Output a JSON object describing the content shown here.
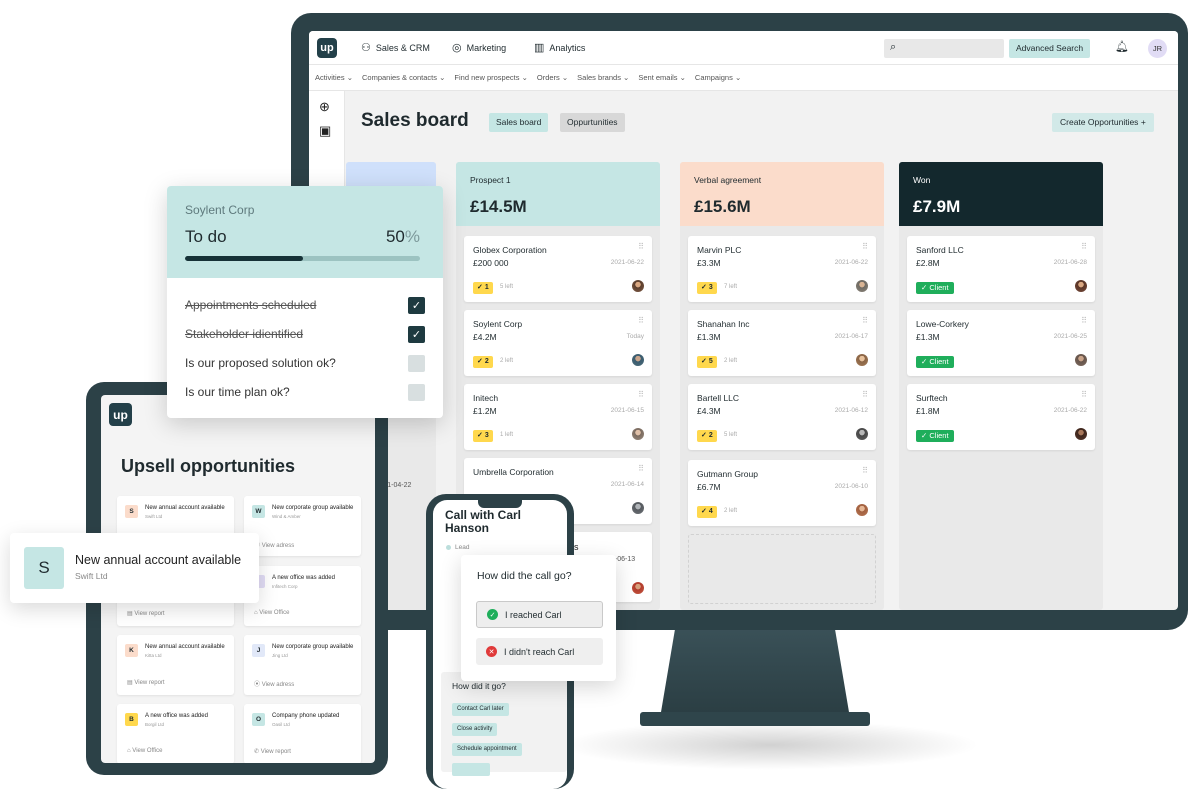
{
  "app": {
    "logo_text": "up",
    "nav": [
      {
        "label": "Sales & CRM",
        "icon": "handshake-icon"
      },
      {
        "label": "Marketing",
        "icon": "target-icon"
      },
      {
        "label": "Analytics",
        "icon": "bar-chart-icon"
      }
    ],
    "advanced_search": "Advanced Search",
    "avatar_initials": "JR",
    "subnav": [
      "Activities",
      "Companies & contacts",
      "Find new prospects",
      "Orders",
      "Sales brands",
      "Sent emails",
      "Campaigns"
    ]
  },
  "board": {
    "title": "Sales board",
    "pill_board": "Sales board",
    "pill_opps": "Oppurtunities",
    "create_button": "Create Opportunities",
    "create_icon": "+",
    "columns": [
      {
        "name": "Prospect 1",
        "amount": "£14.5M",
        "color": "#c5e6e4",
        "cards": [
          {
            "name": "Globex Corporation",
            "amount": "£200 000",
            "date": "2021-06-22",
            "count": "1",
            "left": "5 left"
          },
          {
            "name": "Soylent Corp",
            "amount": "£4.2M",
            "date": "Today",
            "count": "2",
            "left": "2 left"
          },
          {
            "name": "Initech",
            "amount": "£1.2M",
            "date": "2021-06-15",
            "count": "3",
            "left": "1 left"
          },
          {
            "name": "Umbrella Corporation",
            "amount": "",
            "date": "2021-06-14",
            "count": "",
            "left": ""
          }
        ]
      },
      {
        "name": "Verbal agreement",
        "amount": "£15.6M",
        "color": "#fbdccb",
        "cards": [
          {
            "name": "Marvin PLC",
            "amount": "£3.3M",
            "date": "2021-06-22",
            "count": "3",
            "left": "7 left"
          },
          {
            "name": "Shanahan Inc",
            "amount": "£1.3M",
            "date": "2021-06-17",
            "count": "5",
            "left": "2 left"
          },
          {
            "name": "Bartell LLC",
            "amount": "£4.3M",
            "date": "2021-06-12",
            "count": "2",
            "left": "5 left"
          },
          {
            "name": "Gutmann Group",
            "amount": "£6.7M",
            "date": "2021-06-10",
            "count": "4",
            "left": "2 left"
          }
        ]
      },
      {
        "name": "Won",
        "amount": "£7.9M",
        "color": "#13282d",
        "cards": [
          {
            "name": "Sanford LLC",
            "amount": "£2.8M",
            "date": "2021-06-28",
            "badge": "Client"
          },
          {
            "name": "Lowe-Corkery",
            "amount": "£1.3M",
            "date": "2021-06-25",
            "badge": "Client"
          },
          {
            "name": "Surftech",
            "amount": "£1.8M",
            "date": "2021-06-22",
            "badge": "Client"
          }
        ]
      }
    ],
    "peek_date_1": "-21-04-22",
    "peek_date_2": "1-06-13",
    "peek_text": "ers"
  },
  "todo": {
    "company": "Soylent Corp",
    "title": "To do",
    "percent": "50",
    "percent_sign": "%",
    "progress": 0.5,
    "items": [
      {
        "label": "Appointments scheduled",
        "done": true
      },
      {
        "label": "Stakeholder idientified",
        "done": true
      },
      {
        "label": "Is our proposed solution ok?",
        "done": false
      },
      {
        "label": "Is our time plan ok?",
        "done": false
      }
    ]
  },
  "tablet": {
    "logo_text": "up",
    "title": "Upsell opportunities",
    "cards": [
      {
        "badge": "S",
        "title": "New annual account available",
        "sub": "Swift Ltd",
        "action": "View report",
        "badge_color": "#fbdccb"
      },
      {
        "badge": "W",
        "title": "New corporate group available",
        "sub": "Wind & Amber",
        "action": "View adress",
        "badge_color": "#c5e6e4"
      },
      {
        "badge": "",
        "title": "",
        "sub": "",
        "action": "View report",
        "badge_color": "#ffffff"
      },
      {
        "badge": "I",
        "title": "A new office was added",
        "sub": "Infitech Corp",
        "action": "View Office",
        "badge_color": "#e1dcf5"
      },
      {
        "badge": "K",
        "title": "New annual account available",
        "sub": "Kitta Ltd",
        "action": "View report",
        "badge_color": "#fbdccb"
      },
      {
        "badge": "J",
        "title": "New corporate group available",
        "sub": "Jing Ltd",
        "action": "View adress",
        "badge_color": "#e1e8f8"
      },
      {
        "badge": "B",
        "title": "A new office was added",
        "sub": "Borgil Ltd",
        "action": "View Office",
        "badge_color": "#ffd84d"
      },
      {
        "badge": "O",
        "title": "Company phone updated",
        "sub": "Oasil Ltd",
        "action": "View report",
        "badge_color": "#c5e6e4"
      }
    ]
  },
  "popup": {
    "badge": "S",
    "title": "New annual account available",
    "sub": "Swift Ltd"
  },
  "phone": {
    "title": "Call with Carl Hanson",
    "lead": "Lead",
    "did_it_title": "How did it go?",
    "chips": [
      "Contact Carl later",
      "Close activity",
      "Schedule appointment"
    ]
  },
  "call_dialog": {
    "title": "How did the call go?",
    "reached": "I reached Carl",
    "not_reached": "I didn't reach Carl"
  }
}
